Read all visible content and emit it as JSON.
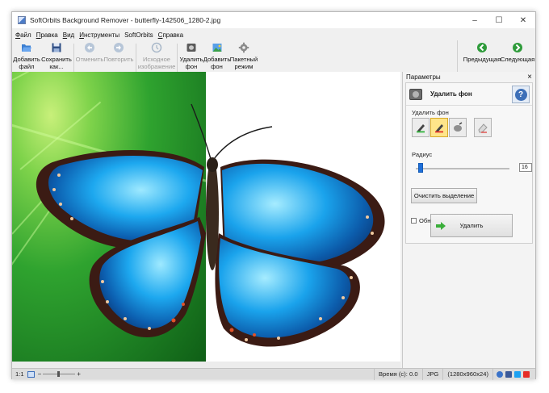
{
  "window": {
    "title": "SoftOrbits Background Remover - butterfly-142506_1280-2.jpg",
    "controls": {
      "minimize": "–",
      "maximize": "☐",
      "close": "✕"
    }
  },
  "menu": [
    {
      "prefix": "",
      "accel": "Ф",
      "rest": "айл"
    },
    {
      "prefix": "",
      "accel": "П",
      "rest": "равка"
    },
    {
      "prefix": "",
      "accel": "В",
      "rest": "ид"
    },
    {
      "prefix": "",
      "accel": "И",
      "rest": "нструменты"
    },
    {
      "prefix": "SoftOrbits",
      "accel": "",
      "rest": ""
    },
    {
      "prefix": "",
      "accel": "С",
      "rest": "правка"
    }
  ],
  "toolbar": {
    "add_file": [
      "Добавить",
      "файл"
    ],
    "save_as": [
      "Сохранить",
      "как..."
    ],
    "undo": "Отменить",
    "redo": "Повторить",
    "original_image": [
      "Исходное",
      "изображение"
    ],
    "remove_bg": [
      "Удалить",
      "фон"
    ],
    "add_bg": [
      "Добавить",
      "фон"
    ],
    "batch_mode": [
      "Пакетный",
      "режим"
    ],
    "prev": "Предыдущая",
    "next": "Следующая"
  },
  "panel": {
    "header": "Параметры",
    "close": "×",
    "title": "Удалить фон",
    "help": "?",
    "remove_bg_label": "Удалить фон",
    "radius_label": "Радиус",
    "radius_value": "16",
    "clear_selection": "Очистить выделение",
    "shadow_detection": "Обнаружение теней",
    "delete_button": "Удалить"
  },
  "status": {
    "zoom_ratio": "1:1",
    "time": "Время (с): 0.0",
    "format": "JPG",
    "dimensions": "(1280x960x24)"
  },
  "colors": {
    "butterfly_blue": "#1da8ef",
    "butterfly_edge": "#3b1b14",
    "leaf_green": "#2fa32f",
    "slider_blue": "#1e6fd9",
    "active_tool": "#ffe58a",
    "nav_green": "#2e9b3a"
  },
  "icons": {
    "add_file": "folder-open-icon",
    "save_as": "floppy-disk-icon",
    "undo": "undo-arrow-icon",
    "redo": "redo-arrow-icon",
    "original_image": "original-image-icon",
    "remove_bg": "remove-background-icon",
    "add_bg": "add-background-icon",
    "batch_mode": "gear-icon",
    "prev": "green-back-arrow-icon",
    "next": "green-forward-arrow-icon",
    "help": "question-mark-icon"
  }
}
